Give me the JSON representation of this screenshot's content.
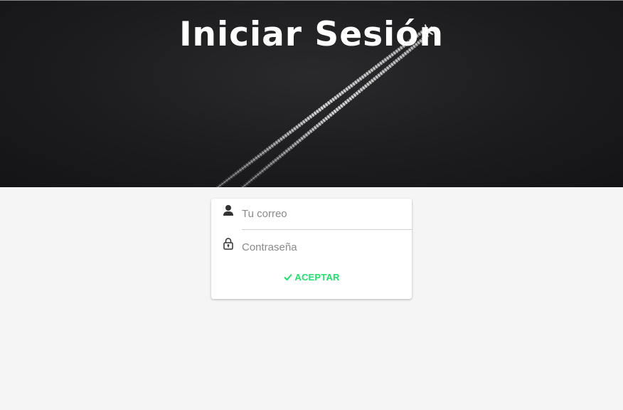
{
  "header": {
    "title": "Iniciar Sesión"
  },
  "login": {
    "email_placeholder": "Tu correo",
    "password_placeholder": "Contraseña",
    "submit_label": "ACEPTAR"
  },
  "icons": {
    "email": "user-icon",
    "password": "lock-icon",
    "submit": "check-icon"
  },
  "colors": {
    "accent": "#1ee36a",
    "hero_background": "#1c1c1e",
    "page_background": "#f5f5f5"
  }
}
